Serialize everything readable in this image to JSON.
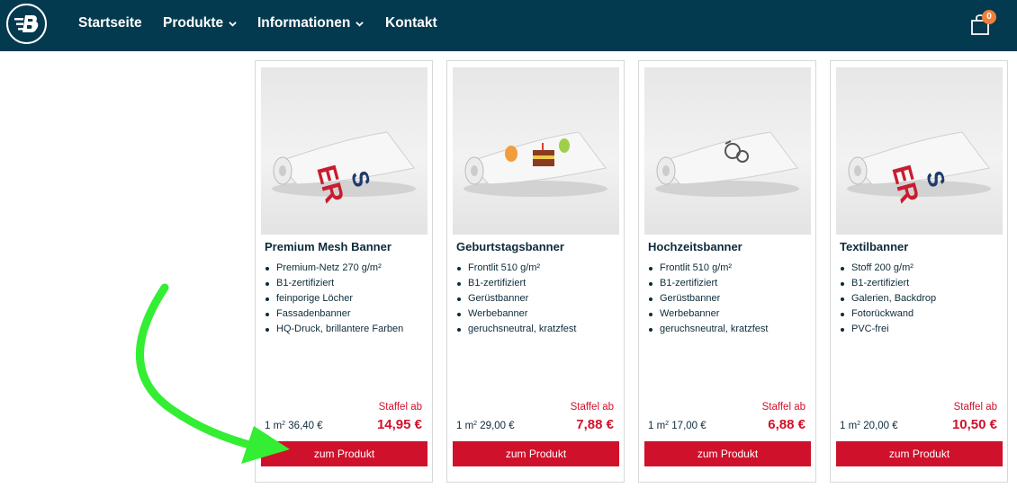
{
  "nav": {
    "items": [
      {
        "label": "Startseite"
      },
      {
        "label": "Produkte"
      },
      {
        "label": "Informationen"
      },
      {
        "label": "Kontakt"
      }
    ],
    "cart_count": "0"
  },
  "colors": {
    "navbar": "#033a4f",
    "accent_red": "#d0112b",
    "badge_orange": "#f07f3c",
    "annotation_green": "#33ee33"
  },
  "products": [
    {
      "title": "Premium Mesh Banner",
      "features": [
        "Premium-Netz 270 g/m²",
        "B1-zertifiziert",
        "feinporige Löcher",
        "Fassadenbanner",
        "HQ-Druck, brillantere Farben"
      ],
      "staffel": "Staffel ab",
      "price": "14,95 €",
      "unit_prefix": "1 m",
      "unit_sup": "2",
      "unit_price": " 36,40 €",
      "button": "zum Produkt"
    },
    {
      "title": "Geburtstagsbanner",
      "features": [
        "Frontlit 510 g/m²",
        "B1-zertifiziert",
        "Gerüstbanner",
        "Werbebanner",
        "geruchsneutral, kratzfest"
      ],
      "staffel": "Staffel ab",
      "price": "7,88 €",
      "unit_prefix": "1 m",
      "unit_sup": "2",
      "unit_price": " 29,00 €",
      "button": "zum Produkt"
    },
    {
      "title": "Hochzeitsbanner",
      "features": [
        "Frontlit 510 g/m²",
        "B1-zertifiziert",
        "Gerüstbanner",
        "Werbebanner",
        "geruchsneutral, kratzfest"
      ],
      "staffel": "Staffel ab",
      "price": "6,88 €",
      "unit_prefix": "1 m",
      "unit_sup": "2",
      "unit_price": " 17,00 €",
      "button": "zum Produkt"
    },
    {
      "title": "Textilbanner",
      "features": [
        "Stoff 200 g/m²",
        "B1-zertifiziert",
        "Galerien, Backdrop",
        "Fotorückwand",
        "PVC-frei"
      ],
      "staffel": "Staffel ab",
      "price": "10,50 €",
      "unit_prefix": "1 m",
      "unit_sup": "2",
      "unit_price": " 20,00 €",
      "button": "zum Produkt"
    }
  ]
}
